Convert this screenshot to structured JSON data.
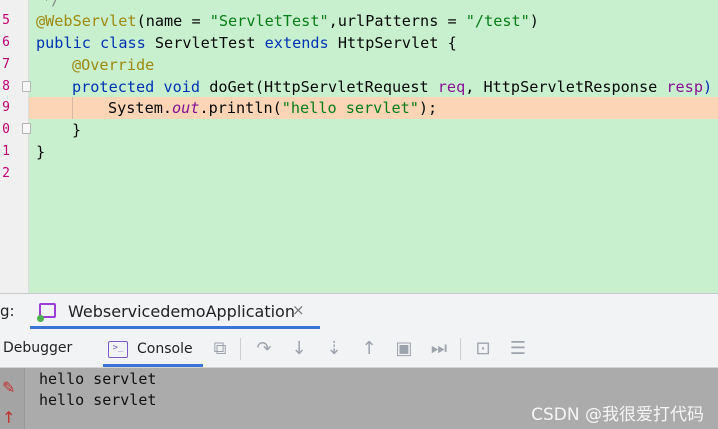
{
  "editor": {
    "line_numbers": [
      "5",
      "6",
      "7",
      "8",
      "9",
      "0",
      "1",
      "2"
    ],
    "annotation_webservlet": "@WebServlet",
    "l1_open": "(name = ",
    "l1_name": "\"ServletTest\"",
    "l1_mid": ",urlPatterns = ",
    "l1_pattern": "\"/test\"",
    "l1_close": ")",
    "kw_public": "public",
    "kw_class": "class",
    "class_name": "ServletTest",
    "kw_extends": "extends",
    "super_class": "HttpServlet",
    "open_brace": "{",
    "annotation_override": "@Override",
    "kw_protected": "protected",
    "kw_void": "void",
    "method_sig": "doGet(HttpServletRequest ",
    "param_req": "req",
    "sig_mid": ", HttpServletResponse ",
    "param_resp": "resp",
    "sig_tail": ") t",
    "println_head": "System.",
    "println_field": "out",
    "println_call": ".println(",
    "println_arg": "\"hello servlet\"",
    "println_end": ");",
    "inner_close": "}",
    "outer_close": "}",
    "top_fragment": "*/"
  },
  "tool_window": {
    "label": "g:",
    "run_tab": "WebservicedemoApplication",
    "run_tab_close": "×",
    "tab_debugger": "Debugger",
    "tab_console": "Console",
    "console_icon_glyph": ">_"
  },
  "console": {
    "lines": [
      "hello servlet",
      "hello servlet"
    ]
  },
  "watermark": "CSDN @我很爱打代码",
  "colors": {
    "editor_bg": "#c8f0cf",
    "highlight_line": "#fbd5b6",
    "keyword": "#0033b3",
    "string": "#067d17",
    "annotation": "#9e880d",
    "accent": "#3a74d6"
  },
  "toolbar_icons": [
    "layout-icon",
    "rerun-icon",
    "step-over-icon",
    "step-into-icon",
    "step-out-icon",
    "evaluate-icon",
    "resume-icon",
    "console-view-icon",
    "list-icon"
  ]
}
